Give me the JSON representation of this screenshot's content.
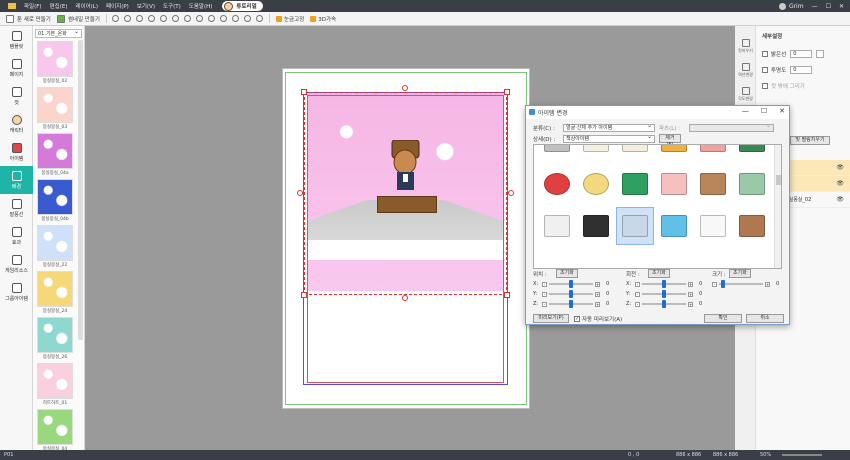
{
  "menu": {
    "items": [
      "파일(F)",
      "편집(E)",
      "레이어(L)",
      "페이지(P)",
      "보기(V)",
      "도구(T)",
      "도움말(H)"
    ],
    "tutorial": "튜토리얼",
    "user": "Grim"
  },
  "toolbar": {
    "new_toon": "툰 새로 만들기",
    "thumbnail": "썸네일 만들기",
    "grid_snap": "눈금고정",
    "three_d": "3D가속"
  },
  "rail": [
    {
      "label": "템플릿"
    },
    {
      "label": "페이지"
    },
    {
      "label": "컷"
    },
    {
      "label": "캐릭터"
    },
    {
      "label": "아이템"
    },
    {
      "label": "배경"
    },
    {
      "label": "말풍선"
    },
    {
      "label": "효과"
    },
    {
      "label": "게임리소스"
    },
    {
      "label": "그룹아이템"
    }
  ],
  "assets": {
    "category": "01.기본_온화",
    "items": [
      {
        "label": "몽실몽실_02",
        "color": "#f8c8ec"
      },
      {
        "label": "몽실몽실_03",
        "color": "#fbd5cc"
      },
      {
        "label": "몽실몽실_04a",
        "color": "#d47ad8"
      },
      {
        "label": "몽실몽실_04b",
        "color": "#3a5ad0"
      },
      {
        "label": "몽실몽실_22",
        "color": "#cfe0f8"
      },
      {
        "label": "몽실몽실_24",
        "color": "#f6d878"
      },
      {
        "label": "몽실몽실_26",
        "color": "#8ed8d0"
      },
      {
        "label": "히트하트_01",
        "color": "#f8d0e0"
      },
      {
        "label": "몽실몽실_04",
        "color": "#9ad880"
      }
    ]
  },
  "right": {
    "rail": [
      "컷지우기",
      "역선변경",
      "각도변경"
    ],
    "title": "세부설정",
    "brightness_label": "밝은선",
    "brightness_value": "0",
    "opacity_label": "투명도",
    "opacity_value": "0",
    "bg_label": "컷 밖에 그리기",
    "bg_button": "및 필링지우기",
    "layers": [
      {
        "label": "",
        "highlight": true
      },
      {
        "label": "",
        "highlight": true
      },
      {
        "label": "몽실몽실_02",
        "highlight": false
      }
    ]
  },
  "dialog": {
    "title": "아이템 변경",
    "category_label": "분류(C) :",
    "category_value": "얼굴·신체 추가 아이템",
    "parts_label": "파츠(L) :",
    "detail_label": "상세(D) :",
    "detail_value": "책상아이템",
    "remove_button": "제거(E)",
    "position_label": "위치 :",
    "rotation_label": "회전 :",
    "size_label": "크기 :",
    "reset_label": "초기화",
    "preview_button": "미리보기(P)",
    "auto_preview_label": "자동 미리보기(A)",
    "ok_button": "확인",
    "cancel_button": "취소",
    "axes": {
      "position": [
        {
          "axis": "X:",
          "value": "0"
        },
        {
          "axis": "Y:",
          "value": "0"
        },
        {
          "axis": "Z:",
          "value": "0"
        }
      ],
      "rotation": [
        {
          "axis": "X:",
          "value": "0"
        },
        {
          "axis": "Y:",
          "value": "0"
        },
        {
          "axis": "Z:",
          "value": "0"
        }
      ],
      "size": [
        {
          "axis": "",
          "value": "0"
        }
      ]
    },
    "grid_rows": [
      [
        "#c0c0c0",
        "#f4f0e0",
        "#f5eedc",
        "#f0b040",
        "#f3a0a0",
        "#3a8a50"
      ],
      [
        "#e04040",
        "#f3d880",
        "#30a060",
        "#f6c0c0",
        "#b8865a",
        "#9ac8a8"
      ],
      [
        "#f0f0f0",
        "#303030",
        "#c8d8e8",
        "#60c0e8",
        "#f8f8f8",
        "#b07850"
      ]
    ]
  },
  "status": {
    "left": "P01",
    "coords": "0 , 0",
    "size": "886 x 886",
    "zoom_px": "886 x 886",
    "zoom": "50%"
  }
}
